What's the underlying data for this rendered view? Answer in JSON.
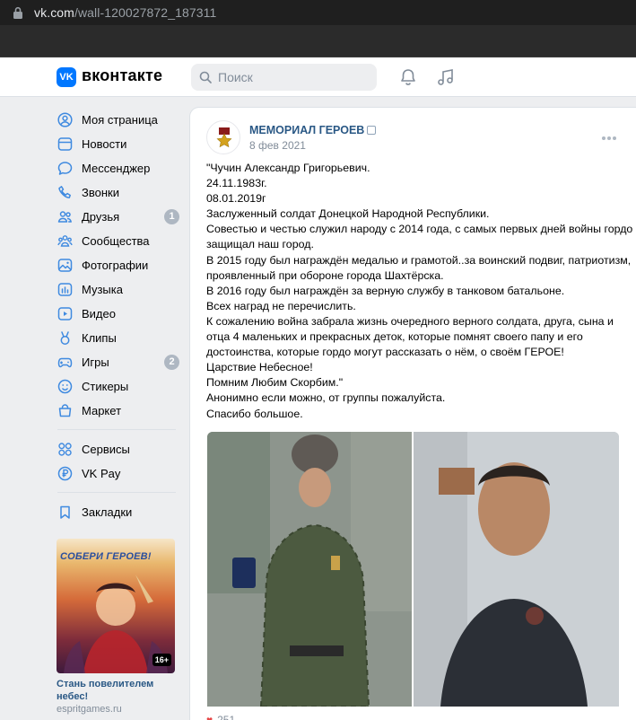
{
  "browser": {
    "url_host": "vk.com",
    "url_path": "/wall-120027872_187311"
  },
  "header": {
    "logo_text": "VK",
    "title": "вконтакте",
    "search_placeholder": "Поиск",
    "accent": "#0077ff"
  },
  "sidebar": {
    "items": [
      {
        "label": "Моя страница",
        "icon": "user-circle-icon"
      },
      {
        "label": "Новости",
        "icon": "news-icon"
      },
      {
        "label": "Мессенджер",
        "icon": "message-icon"
      },
      {
        "label": "Звонки",
        "icon": "phone-icon"
      },
      {
        "label": "Друзья",
        "icon": "friends-icon",
        "badge": "1"
      },
      {
        "label": "Сообщества",
        "icon": "communities-icon"
      },
      {
        "label": "Фотографии",
        "icon": "photo-icon"
      },
      {
        "label": "Музыка",
        "icon": "music-icon"
      },
      {
        "label": "Видео",
        "icon": "video-icon"
      },
      {
        "label": "Клипы",
        "icon": "clips-icon"
      },
      {
        "label": "Игры",
        "icon": "games-icon",
        "badge": "2"
      },
      {
        "label": "Стикеры",
        "icon": "sticker-icon"
      },
      {
        "label": "Маркет",
        "icon": "market-icon"
      }
    ],
    "items2": [
      {
        "label": "Сервисы",
        "icon": "services-icon"
      },
      {
        "label": "VK Pay",
        "icon": "vkpay-icon"
      }
    ],
    "items3": [
      {
        "label": "Закладки",
        "icon": "bookmark-icon"
      }
    ],
    "promo": {
      "image_title": "СОБЕРИ ГЕРОЕВ!",
      "age": "16+",
      "name": "Стань повелителем небес!",
      "site": "espritgames.ru"
    }
  },
  "post": {
    "author": "МЕМОРИАЛ ГЕРОЕВ",
    "date": "8 фев 2021",
    "lines": [
      "\"Чучин Александр Григорьевич.",
      "24.11.1983г.",
      "08.01.2019г",
      "Заслуженный солдат Донецкой Народной Республики.",
      "Совестью и честью служил народу с 2014 года, с самых первых дней войны гордо",
      "защищал наш город.",
      "В 2015 году был награждён медалью и грамотой..за воинский подвиг, патриотизм,",
      "проявленный при обороне города Шахтёрска.",
      "В 2016 году был награждён за верную службу в танковом батальоне.",
      "Всех наград не перечислить.",
      "К сожалению война забрала жизнь очередного верного солдата, друга, сына и",
      "отца 4 маленьких и прекрасных деток, которые помнят своего папу и его",
      "достоинства, которые гордо могут рассказать о нём, о своём ГЕРОЕ!",
      "Царствие Небесное!",
      "Помним Любим Скорбим.\"",
      "Анонимно если можно, от группы пожалуйста.",
      "Спасибо большое."
    ],
    "likes": "251"
  }
}
